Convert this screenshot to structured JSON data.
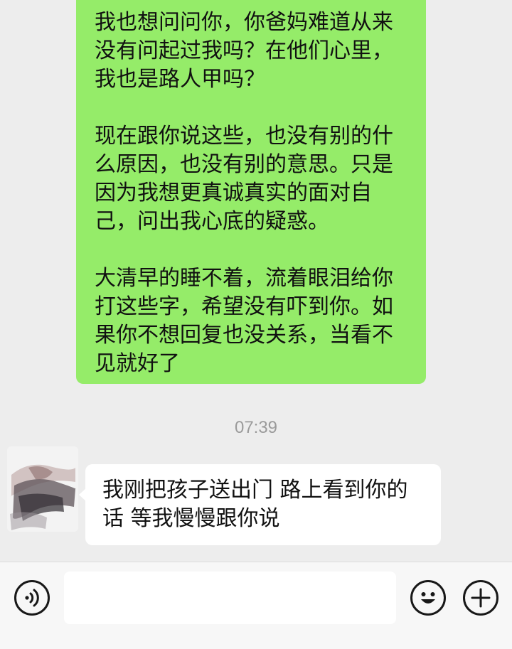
{
  "messages": {
    "sent": {
      "paragraphs": [
        "我也想问问你，你爸妈难道从来没有问起过我吗？在他们心里，我也是路人甲吗？",
        "现在跟你说这些，也没有别的什么原因，也没有别的意思。只是因为我想更真诚真实的面对自己，问出我心底的疑惑。",
        "大清早的睡不着，流着眼泪给你打这些字，希望没有吓到你。如果你不想回复也没关系，当看不见就好了"
      ]
    },
    "timestamp": "07:39",
    "received": {
      "text": "我刚把孩子送出门 路上看到你的话 等我慢慢跟你说"
    }
  },
  "input_bar": {
    "value": "",
    "icons": {
      "voice": "voice-icon",
      "emoji": "emoji-icon",
      "plus": "plus-icon"
    }
  },
  "colors": {
    "background": "#ededed",
    "sent_bubble": "#95ec69",
    "received_bubble": "#ffffff",
    "timestamp": "#9a9a9a",
    "input_bar": "#f7f7f7"
  }
}
